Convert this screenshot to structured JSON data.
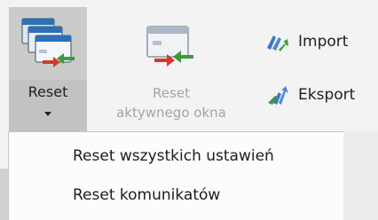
{
  "ribbon": {
    "reset": {
      "label": "Reset",
      "icon": "windows-reset-icon"
    },
    "reset_active": {
      "label_line1": "Reset",
      "label_line2": "aktywnego okna",
      "icon": "window-reset-icon"
    },
    "import": {
      "label": "Import",
      "icon": "import-arrows-icon"
    },
    "export": {
      "label": "Eksport",
      "icon": "export-arrows-icon"
    }
  },
  "dropdown": {
    "items": [
      {
        "label": "Reset wszystkich ustawień"
      },
      {
        "label": "Reset komunikatów"
      }
    ]
  },
  "colors": {
    "accent_green": "#3a9b3a",
    "accent_red": "#d43a2a",
    "blue": "#3b78c4",
    "disabled_text": "#a4a4a4"
  }
}
